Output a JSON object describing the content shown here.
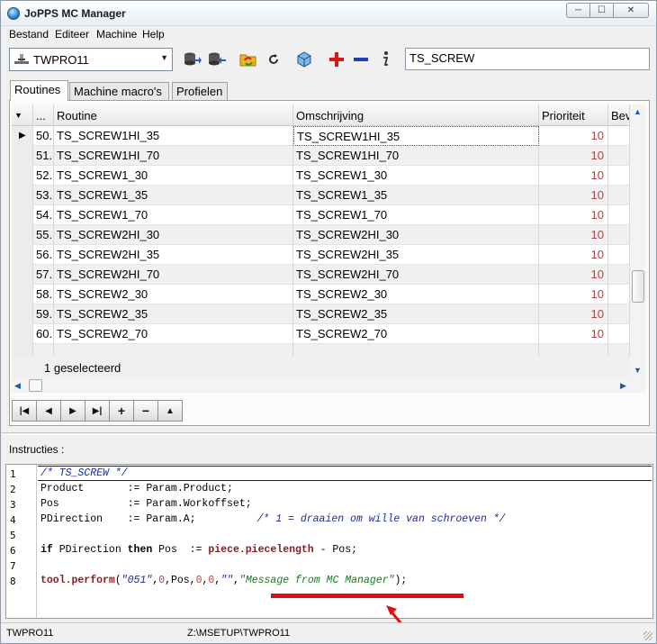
{
  "window": {
    "title": "JoPPS MC Manager"
  },
  "menu": [
    "Bestand",
    "Editeer",
    "Machine",
    "Help"
  ],
  "toolbar": {
    "machine_select": "TWPRO11",
    "search_value": "TS_SCREW"
  },
  "tabs": [
    "Routines",
    "Machine macro's",
    "Profielen"
  ],
  "grid": {
    "columns": [
      "...",
      "Routine",
      "Omschrijving",
      "Prioriteit",
      "Bev"
    ],
    "rows": [
      {
        "nr": "50.",
        "routine": "TS_SCREW1HI_35",
        "omschrijving": "TS_SCREW1HI_35",
        "prioriteit": "10"
      },
      {
        "nr": "51.",
        "routine": "TS_SCREW1HI_70",
        "omschrijving": "TS_SCREW1HI_70",
        "prioriteit": "10"
      },
      {
        "nr": "52.",
        "routine": "TS_SCREW1_30",
        "omschrijving": "TS_SCREW1_30",
        "prioriteit": "10"
      },
      {
        "nr": "53.",
        "routine": "TS_SCREW1_35",
        "omschrijving": "TS_SCREW1_35",
        "prioriteit": "10"
      },
      {
        "nr": "54.",
        "routine": "TS_SCREW1_70",
        "omschrijving": "TS_SCREW1_70",
        "prioriteit": "10"
      },
      {
        "nr": "55.",
        "routine": "TS_SCREW2HI_30",
        "omschrijving": "TS_SCREW2HI_30",
        "prioriteit": "10"
      },
      {
        "nr": "56.",
        "routine": "TS_SCREW2HI_35",
        "omschrijving": "TS_SCREW2HI_35",
        "prioriteit": "10"
      },
      {
        "nr": "57.",
        "routine": "TS_SCREW2HI_70",
        "omschrijving": "TS_SCREW2HI_70",
        "prioriteit": "10"
      },
      {
        "nr": "58.",
        "routine": "TS_SCREW2_30",
        "omschrijving": "TS_SCREW2_30",
        "prioriteit": "10"
      },
      {
        "nr": "59.",
        "routine": "TS_SCREW2_35",
        "omschrijving": "TS_SCREW2_35",
        "prioriteit": "10"
      },
      {
        "nr": "60.",
        "routine": "TS_SCREW2_70",
        "omschrijving": "TS_SCREW2_70",
        "prioriteit": "10"
      }
    ],
    "footer": "1  geselecteerd"
  },
  "instructions": {
    "label": "Instructies :",
    "line_numbers": [
      "1",
      "2",
      "3",
      "4",
      "5",
      "6",
      "7",
      "8"
    ],
    "code": {
      "l1": "/* TS_SCREW */",
      "l2_a": "Product       := Param.Product;",
      "l3_a": "Pos           := Param.Workoffset;",
      "l4_a": "PDirection    := Param.A;",
      "l4_c": "/* 1 = draaien om wille van schroeven */",
      "l6_if": "if",
      "l6_a": " PDirection ",
      "l6_then": "then",
      "l6_b": " Pos  := ",
      "l6_fn": "piece.piecelength",
      "l6_c": " - Pos;",
      "l8_fn": "tool.perform",
      "l8_p1": "(",
      "l8_s1": "\"051\"",
      "l8_p2": ",",
      "l8_n1": "0",
      "l8_p3": ",Pos,",
      "l8_n2": "0",
      "l8_p4": ",",
      "l8_n3": "0",
      "l8_p5": ",",
      "l8_s2": "\"\"",
      "l8_p6": ",",
      "l8_s3": "\"Message from MC Manager\"",
      "l8_p7": ");"
    }
  },
  "status": {
    "left": "TWPRO11",
    "path": "Z:\\MSETUP\\TWPRO11"
  },
  "colors": {
    "annotation": "#e01010",
    "keyword_fn": "#8b1a1a",
    "string": "#1a2c9f",
    "string_msg": "#1a7a1a"
  }
}
